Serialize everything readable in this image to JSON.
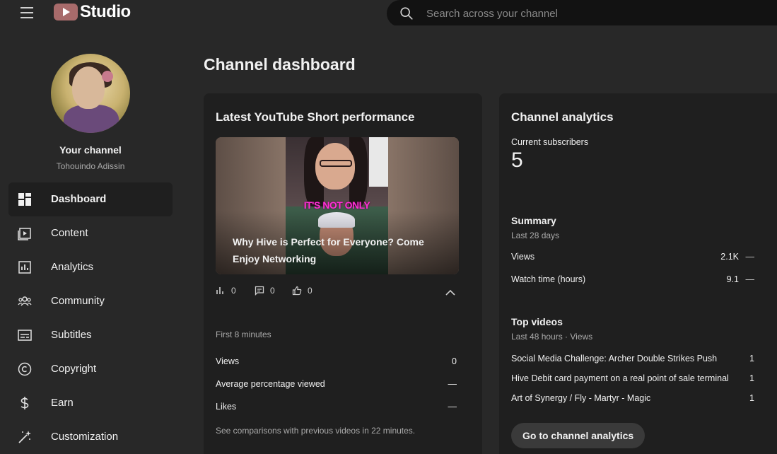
{
  "header": {
    "logo_text": "Studio",
    "search_placeholder": "Search across your channel"
  },
  "sidebar": {
    "channel_title": "Your channel",
    "channel_handle": "Tohouindo Adissin",
    "items": [
      {
        "label": "Dashboard",
        "icon": "dashboard-icon",
        "active": true
      },
      {
        "label": "Content",
        "icon": "content-icon"
      },
      {
        "label": "Analytics",
        "icon": "analytics-icon"
      },
      {
        "label": "Community",
        "icon": "community-icon"
      },
      {
        "label": "Subtitles",
        "icon": "subtitles-icon"
      },
      {
        "label": "Copyright",
        "icon": "copyright-icon"
      },
      {
        "label": "Earn",
        "icon": "earn-icon"
      },
      {
        "label": "Customization",
        "icon": "customization-icon"
      }
    ]
  },
  "main": {
    "page_title": "Channel dashboard",
    "short_card": {
      "title": "Latest YouTube Short performance",
      "thumbnail_caption": "IT'S NOT ONLY",
      "video_title": "Why Hive is Perfect for Everyone? Come Enjoy Networking",
      "stats": {
        "views": "0",
        "comments": "0",
        "likes": "0"
      },
      "period": "First 8 minutes",
      "metrics": [
        {
          "label": "Views",
          "value": "0"
        },
        {
          "label": "Average percentage viewed",
          "value": "—"
        },
        {
          "label": "Likes",
          "value": "—"
        }
      ],
      "compare_note": "See comparisons with previous videos in 22 minutes."
    },
    "analytics_card": {
      "title": "Channel analytics",
      "subscribers_label": "Current subscribers",
      "subscribers_count": "5",
      "summary": {
        "title": "Summary",
        "period": "Last 28 days",
        "rows": [
          {
            "label": "Views",
            "value": "2.1K",
            "trend": "—"
          },
          {
            "label": "Watch time (hours)",
            "value": "9.1",
            "trend": "—"
          }
        ]
      },
      "top_videos": {
        "title": "Top videos",
        "period": "Last 48 hours · Views",
        "rows": [
          {
            "label": "Social Media Challenge: Archer Double Strikes Push",
            "count": "1"
          },
          {
            "label": "Hive Debit card payment on a real point of sale terminal",
            "count": "1"
          },
          {
            "label": "Art of Synergy / Fly - Martyr - Magic",
            "count": "1"
          }
        ]
      },
      "button_label": "Go to channel analytics"
    }
  },
  "colors": {
    "background": "#282828",
    "card": "#1f1f1f",
    "logo_accent": "#a86b6b",
    "thumbnail_caption": "#ff2fd6"
  }
}
